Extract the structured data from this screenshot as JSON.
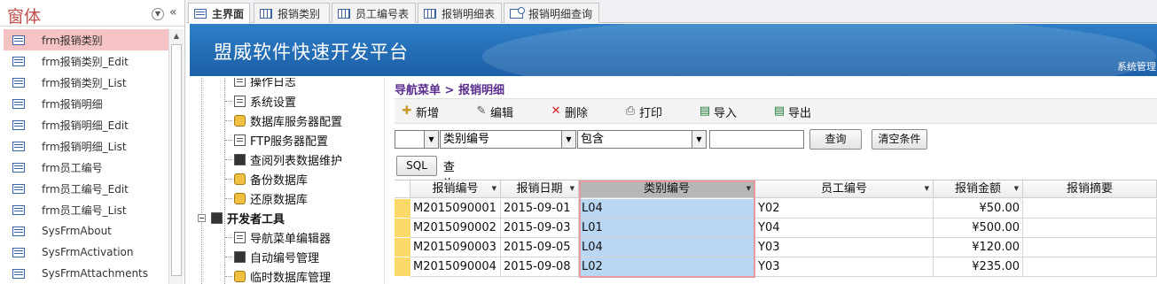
{
  "nav": {
    "title": "窗体",
    "items": [
      {
        "label": "frm报销类别",
        "selected": true
      },
      {
        "label": "frm报销类别_Edit"
      },
      {
        "label": "frm报销类别_List"
      },
      {
        "label": "frm报销明细"
      },
      {
        "label": "frm报销明细_Edit"
      },
      {
        "label": "frm报销明细_List"
      },
      {
        "label": "frm员工编号"
      },
      {
        "label": "frm员工编号_Edit"
      },
      {
        "label": "frm员工编号_List"
      },
      {
        "label": "SysFrmAbout"
      },
      {
        "label": "SysFrmActivation"
      },
      {
        "label": "SysFrmAttachments"
      }
    ]
  },
  "tabs": [
    {
      "label": "主界面",
      "icon": "form-icon",
      "active": true
    },
    {
      "label": "报销类别",
      "icon": "table-icon"
    },
    {
      "label": "员工编号表",
      "icon": "table-icon"
    },
    {
      "label": "报销明细表",
      "icon": "table-icon"
    },
    {
      "label": "报销明细查询",
      "icon": "query-icon"
    }
  ],
  "banner": {
    "title": "盟威软件快速开发平台",
    "right_text": "系统管理"
  },
  "tree": {
    "items": [
      {
        "label": "操作日志",
        "icon": "log-icon"
      },
      {
        "label": "系统设置",
        "icon": "settings-icon"
      },
      {
        "label": "数据库服务器配置",
        "icon": "db-server-icon"
      },
      {
        "label": "FTP服务器配置",
        "icon": "ftp-icon"
      },
      {
        "label": "查阅列表数据维护",
        "icon": "lookup-list-icon"
      },
      {
        "label": "备份数据库",
        "icon": "backup-icon"
      },
      {
        "label": "还原数据库",
        "icon": "restore-icon"
      },
      {
        "label": "开发者工具",
        "icon": "dev-tools-icon",
        "group": true,
        "expander": "−"
      },
      {
        "label": "导航菜单编辑器",
        "icon": "menu-editor-icon"
      },
      {
        "label": "自动编号管理",
        "icon": "autonumber-icon"
      },
      {
        "label": "临时数据库管理",
        "icon": "temp-db-icon"
      }
    ]
  },
  "main": {
    "breadcrumb": "导航菜单 > 报销明细",
    "toolbar": [
      {
        "label": "新增",
        "icon": "new-icon"
      },
      {
        "label": "编辑",
        "icon": "edit-icon"
      },
      {
        "label": "删除",
        "icon": "delete-icon"
      },
      {
        "label": "打印",
        "icon": "print-icon"
      },
      {
        "label": "导入",
        "icon": "import-icon"
      },
      {
        "label": "导出",
        "icon": "export-icon"
      }
    ],
    "filter": {
      "logic_value": "",
      "field_value": "类别编号",
      "operator_value": "包含",
      "text_value": "",
      "query_button": "查询",
      "clear_button": "清空条件"
    },
    "sql": {
      "button": "SQL",
      "label": "查询条件"
    },
    "grid": {
      "columns": [
        "报销编号",
        "报销日期",
        "类别编号",
        "员工编号",
        "报销金额",
        "报销摘要"
      ],
      "rows": [
        [
          "M2015090001",
          "2015-09-01",
          "L04",
          "Y02",
          "¥50.00",
          ""
        ],
        [
          "M2015090002",
          "2015-09-03",
          "L01",
          "Y04",
          "¥500.00",
          ""
        ],
        [
          "M2015090003",
          "2015-09-05",
          "L04",
          "Y03",
          "¥120.00",
          ""
        ],
        [
          "M2015090004",
          "2015-09-08",
          "L02",
          "Y03",
          "¥235.00",
          ""
        ]
      ]
    }
  },
  "colors": {
    "nav_title": "#c0504d",
    "nav_selected": "#f6c3c4",
    "banner": "#1b5fa8",
    "breadcrumb": "#5b2d8e",
    "row_selector": "#fbd86a",
    "selected_column": "#b9d7f3"
  }
}
